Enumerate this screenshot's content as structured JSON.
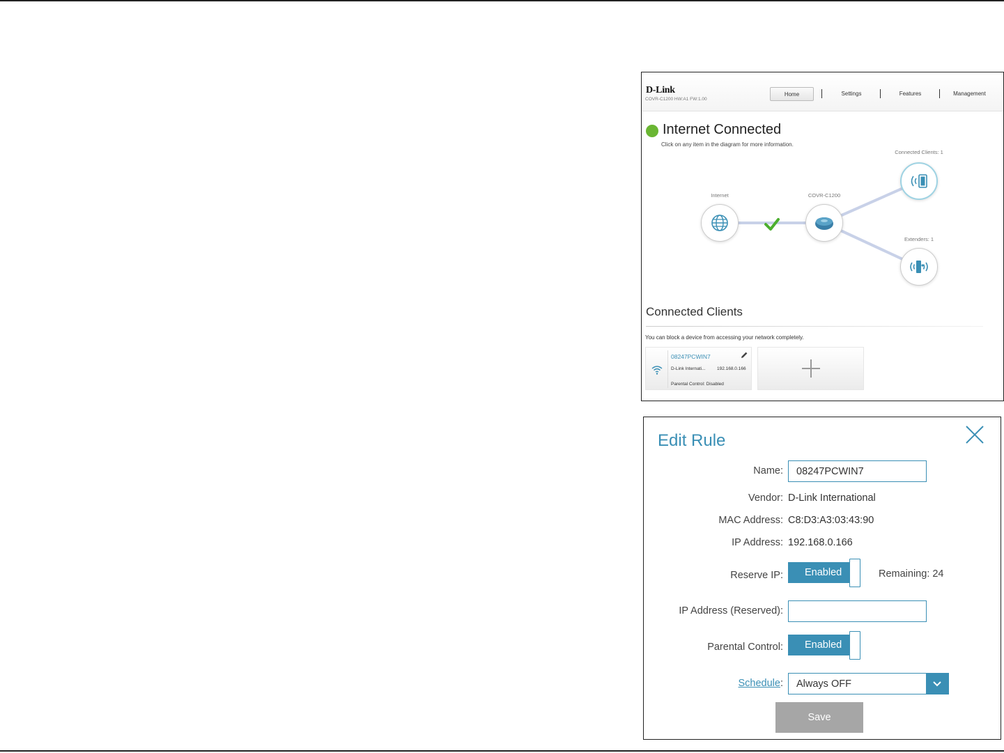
{
  "home": {
    "logo": "D-Link",
    "hw_fw": "COVR-C1200 HW:A1 FW:1.00",
    "nav": [
      "Home",
      "Settings",
      "Features",
      "Management"
    ],
    "active_nav": "Home",
    "status_title": "Internet Connected",
    "status_subtitle": "Click on any item in the diagram for more information.",
    "diagram": {
      "internet_label": "Internet",
      "router_label": "COVR-C1200",
      "clients_label": "Connected Clients: 1",
      "extenders_label": "Extenders: 1"
    },
    "clients_section_title": "Connected Clients",
    "clients_section_subtitle": "You can block a device from accessing your network completely.",
    "client": {
      "name": "08247PCWIN7",
      "vendor": "D-Link Internati...",
      "ip": "192.168.0.166",
      "parental": "Parental Control: Disabled"
    }
  },
  "edit_rule": {
    "title": "Edit Rule",
    "name_label": "Name:",
    "name_value": "08247PCWIN7",
    "vendor_label": "Vendor:",
    "vendor_value": "D-Link International",
    "mac_label": "MAC Address:",
    "mac_value": "C8:D3:A3:03:43:90",
    "ip_label": "IP Address:",
    "ip_value": "192.168.0.166",
    "reserve_ip_label": "Reserve IP:",
    "reserve_ip_state": "Enabled",
    "remaining": "Remaining: 24",
    "ip_reserved_label": "IP Address (Reserved):",
    "ip_reserved_value": "",
    "parental_label": "Parental Control:",
    "parental_state": "Enabled",
    "schedule_link": "Schedule",
    "schedule_colon": ":",
    "schedule_value": "Always OFF",
    "save_label": "Save"
  },
  "colors": {
    "accent": "#3a8fb5",
    "status_green": "#6ab633",
    "save_gray": "#a6a6a6"
  }
}
